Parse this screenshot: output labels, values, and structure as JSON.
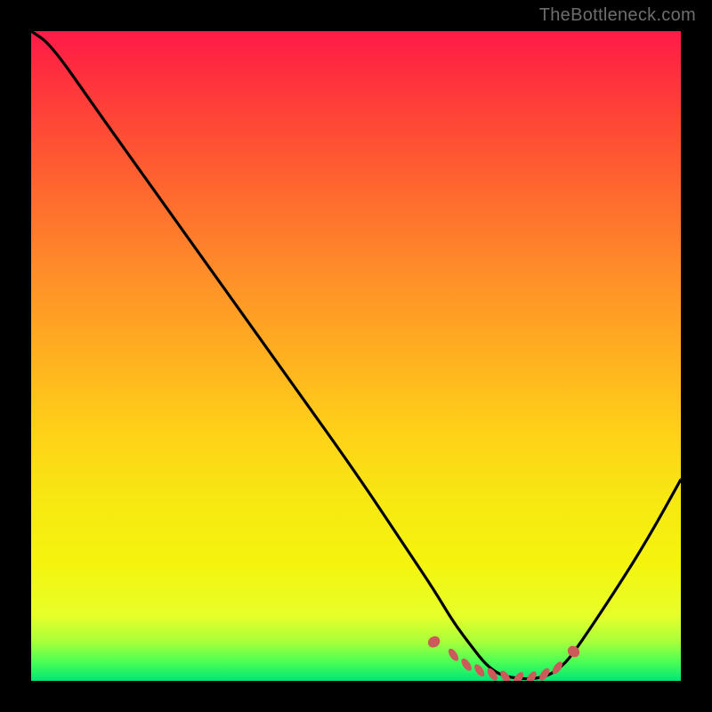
{
  "watermark": "TheBottleneck.com",
  "colors": {
    "frame": "#000000",
    "watermark_text": "#6d6d6d",
    "curve_stroke": "#000000",
    "dot_fill": "#cc5a5a",
    "gradient_top": "#ff1a48",
    "gradient_bottom": "#00e676"
  },
  "chart_data": {
    "type": "line",
    "title": "",
    "xlabel": "",
    "ylabel": "",
    "xlim": [
      0,
      100
    ],
    "ylim": [
      0,
      100
    ],
    "x": [
      0,
      3,
      10,
      20,
      30,
      40,
      50,
      58,
      62,
      65,
      68,
      70,
      72,
      74,
      76,
      78,
      80,
      82,
      84,
      90,
      95,
      100
    ],
    "y": [
      100,
      98,
      88,
      74,
      60,
      46,
      32,
      20,
      14,
      9,
      5,
      2.5,
      1,
      0.5,
      0.3,
      0.4,
      1,
      2.5,
      5,
      14,
      22,
      31
    ],
    "series": [
      {
        "name": "bottleneck-curve",
        "x": [
          0,
          3,
          10,
          20,
          30,
          40,
          50,
          58,
          62,
          65,
          68,
          70,
          72,
          74,
          76,
          78,
          80,
          82,
          84,
          90,
          95,
          100
        ],
        "y": [
          100,
          98,
          88,
          74,
          60,
          46,
          32,
          20,
          14,
          9,
          5,
          2.5,
          1,
          0.5,
          0.3,
          0.4,
          1,
          2.5,
          5,
          14,
          22,
          31
        ]
      },
      {
        "name": "highlight-dots",
        "x": [
          62,
          65,
          67,
          69,
          71,
          73,
          75,
          77,
          79,
          81,
          83.5
        ],
        "y": [
          6,
          4,
          2.5,
          1.6,
          1.0,
          0.6,
          0.4,
          0.5,
          1.0,
          2.0,
          4.5
        ]
      }
    ],
    "annotations": []
  }
}
